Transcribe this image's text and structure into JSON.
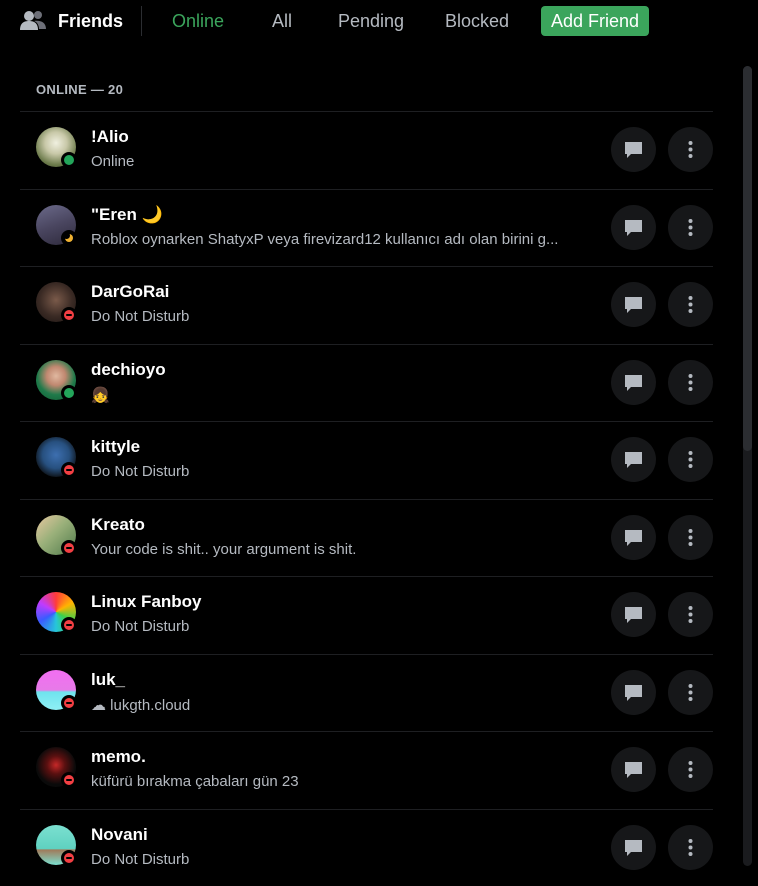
{
  "header": {
    "title": "Friends",
    "tabs": {
      "online": "Online",
      "all": "All",
      "pending": "Pending",
      "blocked": "Blocked"
    },
    "add_friend": "Add Friend"
  },
  "section": {
    "label": "ONLINE — 20"
  },
  "friends": [
    {
      "name": "!Alio",
      "sub": "Online",
      "status": "online"
    },
    {
      "name": "\"Eren 🌙",
      "sub": "Roblox oynarken ShatyxP veya firevizard12 kullanıcı adı olan birini g...",
      "status": "idle"
    },
    {
      "name": "DarGoRai",
      "sub": "Do Not Disturb",
      "status": "dnd"
    },
    {
      "name": "dechioyo",
      "sub": "👧",
      "status": "online"
    },
    {
      "name": "kittyle",
      "sub": "Do Not Disturb",
      "status": "dnd"
    },
    {
      "name": "Kreato",
      "sub": "Your code is shit.. your argument is shit.",
      "status": "dnd"
    },
    {
      "name": "Linux Fanboy",
      "sub": "Do Not Disturb",
      "status": "dnd"
    },
    {
      "name": "luk_",
      "sub": "☁ lukgth.cloud",
      "status": "dnd"
    },
    {
      "name": "memo.",
      "sub": "küfürü bırakma çabaları gün 23",
      "status": "dnd"
    },
    {
      "name": "Novani",
      "sub": "Do Not Disturb",
      "status": "dnd"
    }
  ],
  "colors": {
    "accent_green": "#3ba55c",
    "status_online": "#23a55a",
    "status_dnd": "#f23f43",
    "status_idle": "#f0b232"
  }
}
